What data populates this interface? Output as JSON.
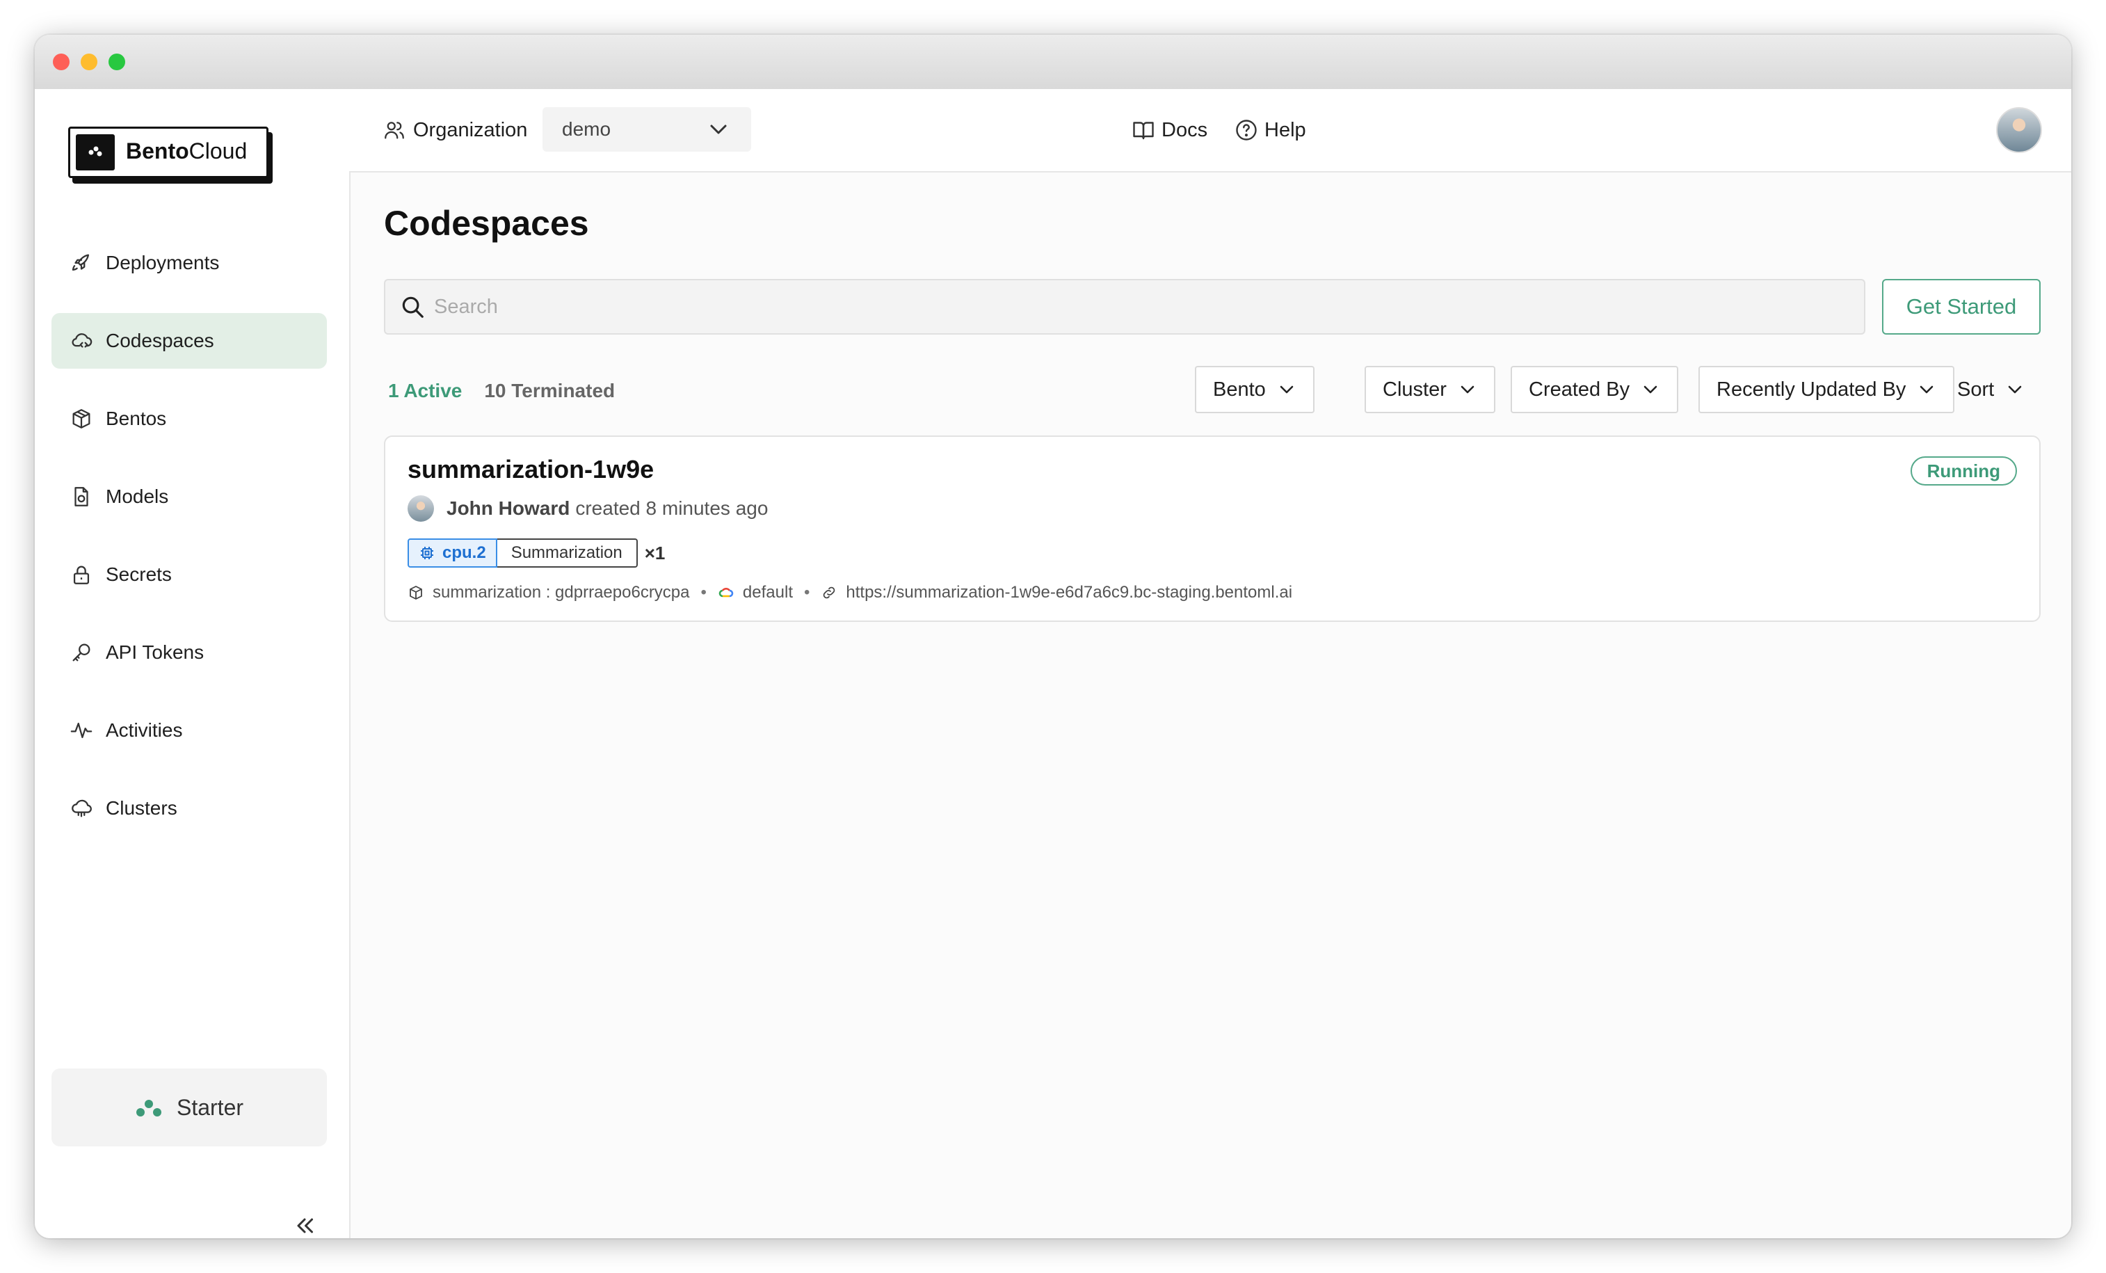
{
  "brand": {
    "name_bold": "Bento",
    "name_regular": "Cloud"
  },
  "sidebar": {
    "items": [
      {
        "label": "Deployments",
        "icon": "rocket-icon"
      },
      {
        "label": "Codespaces",
        "icon": "cloud-code-icon",
        "active": true
      },
      {
        "label": "Bentos",
        "icon": "box-icon"
      },
      {
        "label": "Models",
        "icon": "model-file-icon"
      },
      {
        "label": "Secrets",
        "icon": "lock-icon"
      },
      {
        "label": "API Tokens",
        "icon": "key-icon"
      },
      {
        "label": "Activities",
        "icon": "activity-icon"
      },
      {
        "label": "Clusters",
        "icon": "cluster-icon"
      }
    ],
    "plan": "Starter"
  },
  "header": {
    "org_label": "Organization",
    "org_value": "demo",
    "docs": "Docs",
    "help": "Help"
  },
  "page": {
    "title": "Codespaces",
    "search_placeholder": "Search",
    "get_started": "Get Started",
    "tabs": {
      "active": "1 Active",
      "terminated": "10 Terminated"
    },
    "filters": [
      "Bento",
      "Cluster",
      "Created By",
      "Recently Updated By",
      "Sort"
    ]
  },
  "codespace": {
    "name": "summarization-1w9e",
    "status": "Running",
    "creator": "John Howard",
    "created_text": "created 8 minutes ago",
    "resource": "cpu.2",
    "tag": "Summarization",
    "count": "×1",
    "bento": "summarization : gdprraepo6crycpa",
    "cluster": "default",
    "url": "https://summarization-1w9e-e6d7a6c9.bc-staging.bentoml.ai"
  },
  "colors": {
    "accent": "#3d9a78",
    "active_nav": "#e3efe6",
    "cpu_tag": "#1d6fd1"
  }
}
